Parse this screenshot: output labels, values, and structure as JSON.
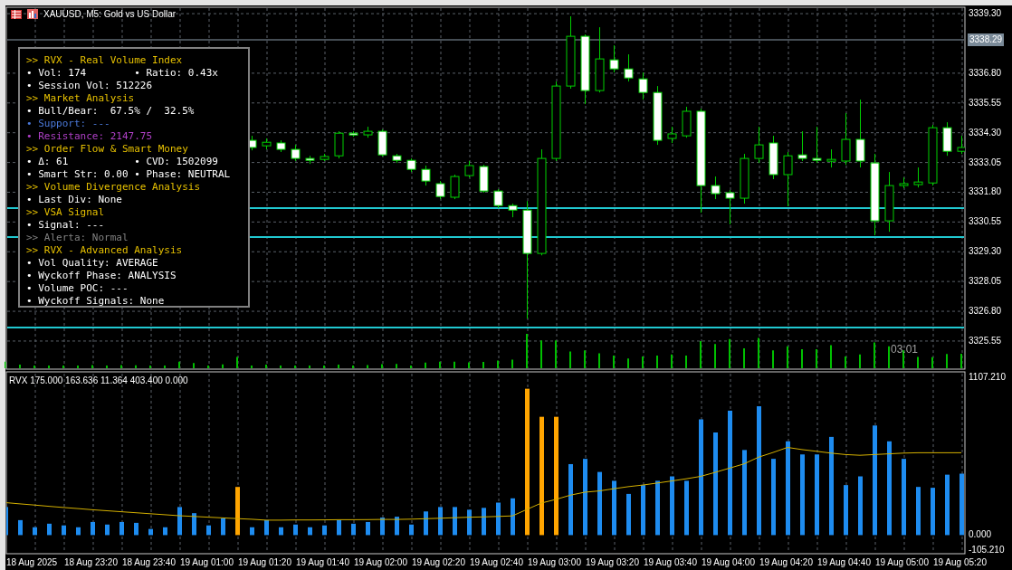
{
  "chart": {
    "title": "XAUUSD, M5: Gold vs US Dollar",
    "current_price": "3338.29",
    "countdown": "03:01",
    "chart_data": {
      "type": "candlestick",
      "ylim": [
        3324.37,
        3339.57
      ],
      "yticks": [
        {
          "value": 3339.3,
          "label": "3339.30"
        },
        {
          "value": 3336.8,
          "label": "3336.80"
        },
        {
          "value": 3335.55,
          "label": "3335.55"
        },
        {
          "value": 3334.3,
          "label": "3334.30"
        },
        {
          "value": 3333.05,
          "label": "3333.05"
        },
        {
          "value": 3331.8,
          "label": "3331.80"
        },
        {
          "value": 3330.55,
          "label": "3330.55"
        },
        {
          "value": 3329.3,
          "label": "3329.30"
        },
        {
          "value": 3328.05,
          "label": "3328.05"
        },
        {
          "value": 3326.8,
          "label": "3326.80"
        },
        {
          "value": 3325.55,
          "label": "3325.55"
        }
      ],
      "categories": [
        null,
        null,
        null,
        null,
        null,
        null,
        null,
        null,
        null,
        null,
        null,
        null,
        null,
        null,
        null,
        null,
        null,
        null,
        null,
        null,
        null,
        null,
        null,
        null,
        null,
        null,
        null,
        null,
        null,
        null,
        null,
        null,
        null,
        null,
        null,
        null,
        null,
        null,
        null,
        null,
        null,
        null,
        null,
        null,
        null,
        null,
        null,
        null,
        null,
        null,
        null,
        null,
        null,
        null,
        null,
        null,
        null,
        null,
        null,
        null,
        null,
        null,
        null,
        null,
        null,
        null,
        null
      ],
      "ohlc": [
        null,
        null,
        null,
        null,
        null,
        null,
        null,
        null,
        null,
        null,
        null,
        null,
        null,
        null,
        null,
        null,
        null,
        [
          3333.98,
          3334.17,
          3333.56,
          3333.68
        ],
        [
          3333.75,
          3334.06,
          3333.6,
          3333.9
        ],
        [
          3333.87,
          3333.98,
          3333.49,
          3333.6
        ],
        [
          3333.6,
          3333.79,
          3333.11,
          3333.22
        ],
        [
          3333.22,
          3333.33,
          3332.99,
          3333.14
        ],
        [
          3333.18,
          3333.41,
          3333.11,
          3333.3
        ],
        [
          3333.33,
          3334.36,
          3333.22,
          3334.28
        ],
        [
          3334.28,
          3334.36,
          3334.13,
          3334.21
        ],
        [
          3334.21,
          3334.55,
          3334.09,
          3334.36
        ],
        [
          3334.36,
          3334.44,
          3333.3,
          3333.37
        ],
        [
          3333.33,
          3333.41,
          3333.03,
          3333.14
        ],
        [
          3333.14,
          3333.22,
          3332.65,
          3332.76
        ],
        [
          3332.76,
          3332.92,
          3332.08,
          3332.27
        ],
        [
          3332.16,
          3332.27,
          3331.51,
          3331.62
        ],
        [
          3331.59,
          3332.54,
          3331.51,
          3332.46
        ],
        [
          3332.5,
          3333.11,
          3332.42,
          3332.92
        ],
        [
          3332.88,
          3332.95,
          3331.78,
          3331.85
        ],
        [
          3331.85,
          3331.93,
          3331.13,
          3331.24
        ],
        [
          3331.24,
          3331.32,
          3330.75,
          3331.05
        ],
        [
          3331.05,
          3331.43,
          3326.49,
          3329.23
        ],
        [
          3329.23,
          3333.6,
          3329.15,
          3333.22
        ],
        [
          3333.22,
          3336.45,
          3333.11,
          3336.26
        ],
        [
          3336.26,
          3339.19,
          3336.15,
          3338.35
        ],
        [
          3338.35,
          3338.43,
          3335.5,
          3336.07
        ],
        [
          3336.07,
          3338.73,
          3335.99,
          3337.4
        ],
        [
          3337.36,
          3337.97,
          3336.83,
          3336.98
        ],
        [
          3336.98,
          3337.59,
          3336.45,
          3336.6
        ],
        [
          3336.56,
          3336.83,
          3335.69,
          3335.99
        ],
        [
          3335.99,
          3336.26,
          3333.79,
          3333.98
        ],
        [
          3334.06,
          3334.55,
          3333.87,
          3334.25
        ],
        [
          3334.17,
          3335.39,
          3334.09,
          3335.2
        ],
        [
          3335.2,
          3335.31,
          3330.94,
          3332.08
        ],
        [
          3332.08,
          3332.46,
          3331.51,
          3331.74
        ],
        [
          3331.78,
          3331.89,
          3330.45,
          3331.55
        ],
        [
          3331.55,
          3333.41,
          3331.32,
          3333.22
        ],
        [
          3333.22,
          3334.55,
          3333.03,
          3333.79
        ],
        [
          3333.87,
          3334.17,
          3332.35,
          3332.54
        ],
        [
          3332.54,
          3333.49,
          3331.21,
          3333.33
        ],
        [
          3333.37,
          3334.36,
          3333.11,
          3333.22
        ],
        [
          3333.22,
          3334.55,
          3333.03,
          3333.14
        ],
        [
          3333.11,
          3333.6,
          3332.84,
          3333.18
        ],
        [
          3333.11,
          3335.12,
          3332.95,
          3334.02
        ],
        [
          3334.02,
          3335.69,
          3332.84,
          3333.11
        ],
        [
          3333.03,
          3333.41,
          3329.99,
          3330.6
        ],
        [
          3330.6,
          3332.65,
          3330.14,
          3332.08
        ],
        [
          3332.08,
          3332.42,
          3331.97,
          3332.16
        ],
        [
          3332.12,
          3332.84,
          3332.0,
          3332.23
        ],
        [
          3332.19,
          3334.63,
          3332.08,
          3334.51
        ],
        [
          3334.51,
          3334.74,
          3333.33,
          3333.52
        ],
        [
          3333.52,
          3334.17,
          3333.41,
          3333.68
        ]
      ]
    }
  },
  "info_panel": {
    "lines": [
      {
        "cells": [
          ">> RVX - Real Volume Index"
        ],
        "color": "#e6c000"
      },
      {
        "cells": [
          "• Vol: 174",
          "• Ratio: 0.43x"
        ],
        "color": "#ffffff"
      },
      {
        "cells": [
          "• Session Vol: 512226"
        ],
        "color": "#ffffff"
      },
      {
        "cells": [
          ">> Market Analysis"
        ],
        "color": "#e6c000"
      },
      {
        "cells": [
          "• Bull/Bear:  67.5% /  32.5%"
        ],
        "color": "#ffffff"
      },
      {
        "cells": [
          "• Support: ---"
        ],
        "color": "#4a78d8"
      },
      {
        "cells": [
          "• Resistance: 2147.75"
        ],
        "color": "#b040c8"
      },
      {
        "cells": [
          ">> Order Flow & Smart Money"
        ],
        "color": "#e6c000"
      },
      {
        "cells": [
          "• Δ: 61",
          "• CVD: 1502099"
        ],
        "color": "#ffffff"
      },
      {
        "cells": [
          "• Smart Str: 0.00",
          "• Phase: NEUTRAL"
        ],
        "color": "#ffffff"
      },
      {
        "cells": [
          ">> Volume Divergence Analysis"
        ],
        "color": "#e6c000"
      },
      {
        "cells": [
          "• Last Div: None"
        ],
        "color": "#ffffff"
      },
      {
        "cells": [
          ">> VSA Signal"
        ],
        "color": "#e6c000"
      },
      {
        "cells": [
          "• Signal: ---"
        ],
        "color": "#ffffff"
      },
      {
        "cells": [
          ">> Alerta: Normal"
        ],
        "color": "#808080"
      },
      {
        "cells": [
          ">> RVX - Advanced Analysis"
        ],
        "color": "#e6c000"
      },
      {
        "cells": [
          "• Vol Quality: AVERAGE"
        ],
        "color": "#ffffff"
      },
      {
        "cells": [
          "• Wyckoff Phase: ANALYSIS"
        ],
        "color": "#ffffff"
      },
      {
        "cells": [
          "• Volume POC: ---"
        ],
        "color": "#ffffff"
      },
      {
        "cells": [
          "• Wyckoff Signals: None"
        ],
        "color": "#ffffff"
      }
    ]
  },
  "indicator": {
    "label": "RVX 175.000 163.636 11.364 403.400 0.000",
    "chart_data": {
      "type": "bar",
      "ylim": [
        -130.6,
        1145.3
      ],
      "yticks": [
        {
          "value": 1107.21,
          "label": "1107.210"
        },
        {
          "value": 0,
          "label": "0.000"
        },
        {
          "value": -105.21,
          "label": "-105.210"
        }
      ],
      "categories": [
        null,
        null,
        null,
        null,
        null,
        null,
        null,
        null,
        null,
        null,
        null,
        null,
        null,
        null,
        null,
        null,
        null,
        null,
        null,
        null,
        null,
        null,
        null,
        null,
        null,
        null,
        null,
        null,
        null,
        null,
        null,
        null,
        null,
        null,
        null,
        null,
        null,
        null,
        null,
        null,
        null,
        null,
        null,
        null,
        null,
        null,
        null,
        null,
        null,
        null,
        null,
        null,
        null,
        null,
        null,
        null,
        null,
        null,
        null,
        null,
        null,
        null,
        null,
        null,
        null,
        null,
        null
      ],
      "series": [
        {
          "color": "#1e8cf0",
          "values": [
            197,
            105,
            55,
            80,
            68,
            55,
            92,
            74,
            92,
            86,
            43,
            55,
            197,
            154,
            68,
            117,
            null,
            55,
            105,
            55,
            74,
            55,
            68,
            105,
            80,
            92,
            123,
            129,
            74,
            166,
            197,
            197,
            178,
            191,
            228,
            258,
            null,
            null,
            null,
            498,
            535,
            443,
            381,
            289,
            351,
            381,
            412,
            381,
            812,
            720,
            873,
            597,
            904,
            535,
            658,
            566,
            566,
            689,
            351,
            412,
            769,
            658,
            535,
            338,
            332,
            424,
            431
          ]
        },
        {
          "color": "#ffa500",
          "values": [
            null,
            null,
            null,
            null,
            null,
            null,
            null,
            null,
            null,
            null,
            null,
            null,
            null,
            null,
            null,
            null,
            338,
            null,
            null,
            null,
            null,
            null,
            null,
            null,
            null,
            null,
            null,
            null,
            null,
            null,
            null,
            null,
            null,
            null,
            null,
            null,
            1027,
            830,
            830,
            null,
            null,
            null,
            null,
            null,
            null,
            null,
            null,
            null,
            null,
            null,
            null,
            null,
            null,
            null,
            null,
            null,
            null,
            null,
            null,
            null,
            null,
            null,
            null,
            null,
            null,
            null,
            null
          ]
        },
        {
          "type": "line",
          "color": "#d4b000",
          "values": [
            228,
            219,
            211,
            202,
            194,
            186,
            178,
            171,
            164,
            157,
            150,
            143,
            136,
            131,
            126,
            121,
            116,
            111,
            105,
            105,
            106,
            106,
            107,
            108,
            108,
            109,
            110,
            110,
            112,
            115,
            118,
            122,
            125,
            128,
            131,
            135,
            180,
            225,
            250,
            280,
            301,
            310,
            325,
            340,
            351,
            365,
            380,
            395,
            412,
            440,
            470,
            500,
            547,
            580,
            615,
            600,
            588,
            575,
            565,
            560,
            565,
            570,
            575,
            578,
            578,
            578,
            578
          ]
        }
      ]
    }
  },
  "time_axis": [
    "18 Aug 2025",
    "18 Aug 23:20",
    "18 Aug 23:40",
    "19 Aug 01:00",
    "19 Aug 01:20",
    "19 Aug 01:40",
    "19 Aug 02:00",
    "19 Aug 02:20",
    "19 Aug 02:40",
    "19 Aug 03:00",
    "19 Aug 03:20",
    "19 Aug 03:40",
    "19 Aug 04:00",
    "19 Aug 04:20",
    "19 Aug 04:40",
    "19 Aug 05:00",
    "19 Aug 05:20"
  ]
}
